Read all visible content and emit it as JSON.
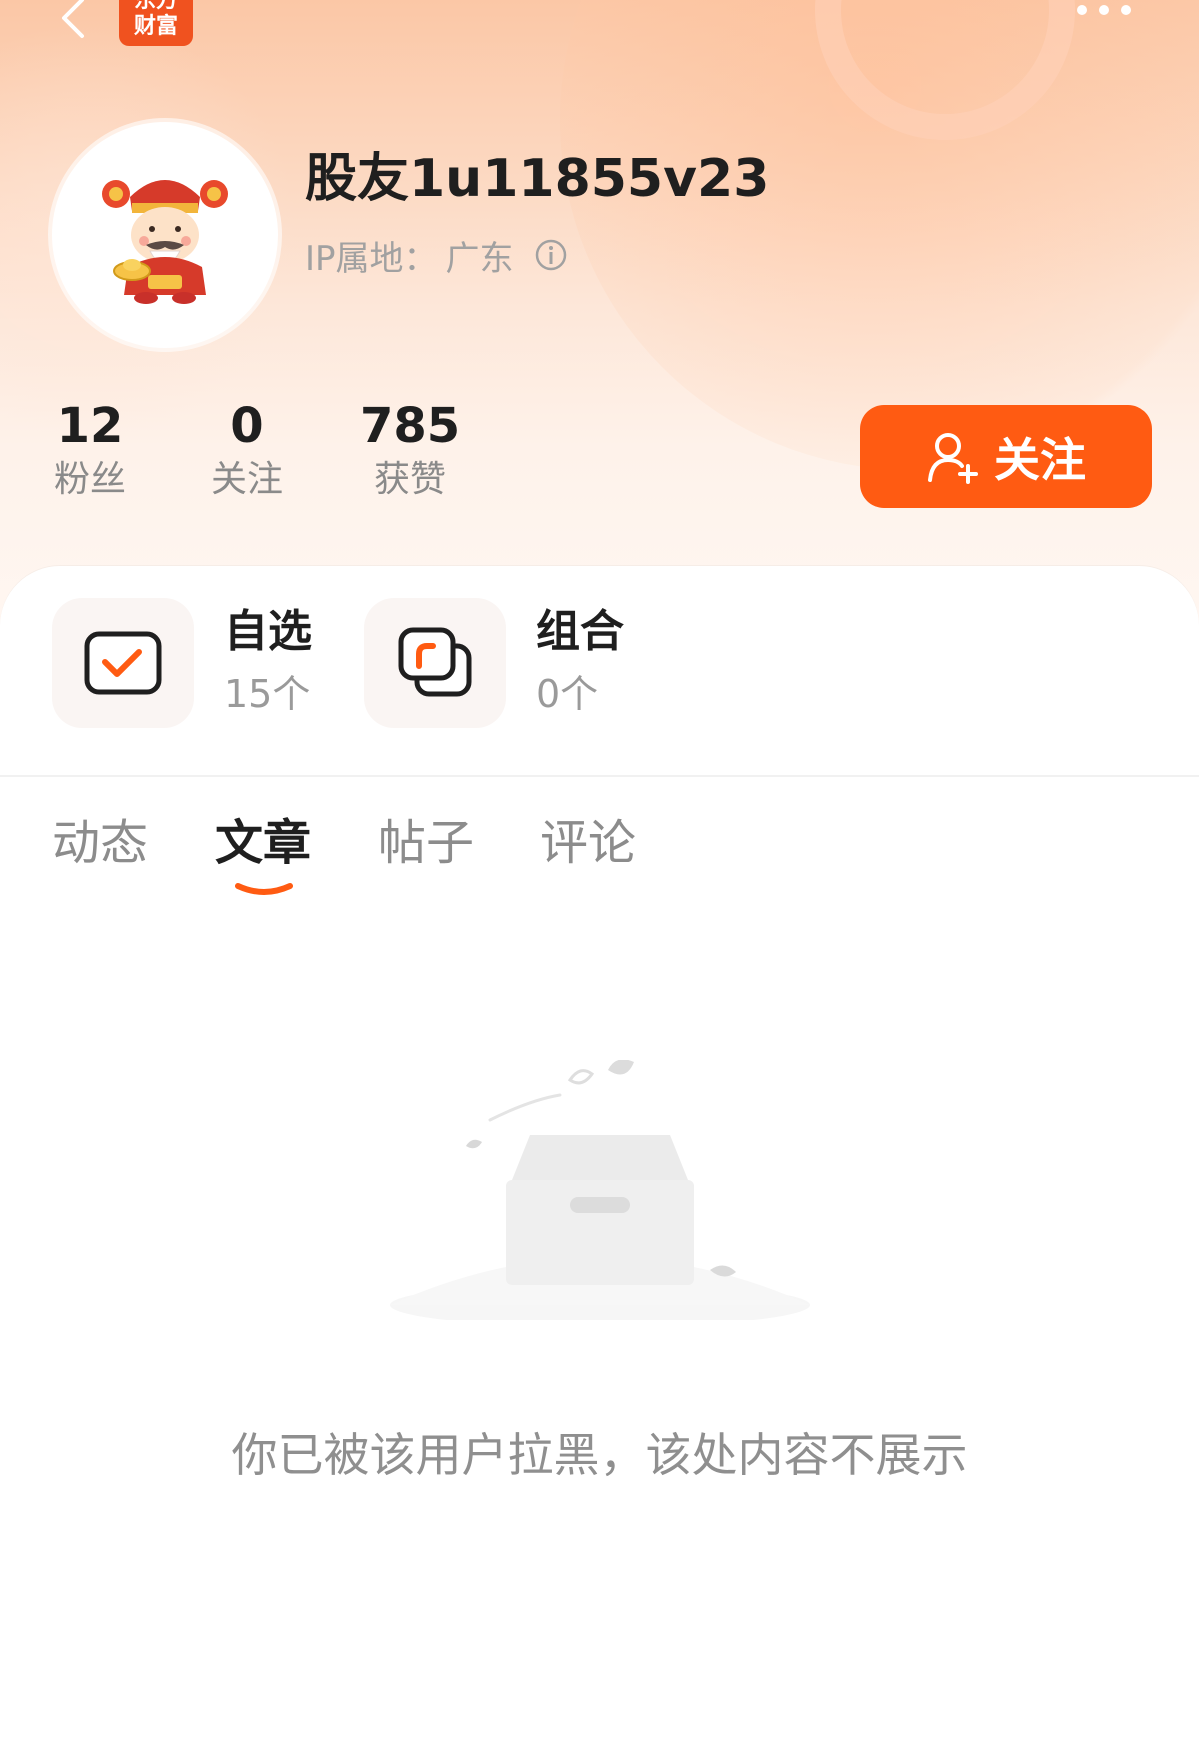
{
  "header": {
    "logo_text": "东方\n财富",
    "back_icon": "chevron-left-icon",
    "more_icon": "more-dots-icon"
  },
  "profile": {
    "username": "股友1u11855v23",
    "ip_label": "IP属地：",
    "ip_value": "广东",
    "info_icon": "info-icon"
  },
  "stats": [
    {
      "num": "12",
      "label": "粉丝"
    },
    {
      "num": "0",
      "label": "关注"
    },
    {
      "num": "785",
      "label": "获赞"
    }
  ],
  "follow_button": {
    "label": "关注",
    "icon": "add-user-icon"
  },
  "quick": [
    {
      "title": "自选",
      "count": "15个",
      "icon": "watchlist-check-icon"
    },
    {
      "title": "组合",
      "count": "0个",
      "icon": "portfolio-icon"
    }
  ],
  "tabs": [
    {
      "label": "动态",
      "active": false
    },
    {
      "label": "文章",
      "active": true
    },
    {
      "label": "帖子",
      "active": false
    },
    {
      "label": "评论",
      "active": false
    }
  ],
  "empty_state": {
    "illustration": "empty-box-icon",
    "message": "你已被该用户拉黑，该处内容不展示"
  },
  "colors": {
    "accent": "#ff5b12",
    "brand": "#f0521f",
    "text_primary": "#1f1f1f",
    "text_secondary": "#8c8c8c"
  }
}
